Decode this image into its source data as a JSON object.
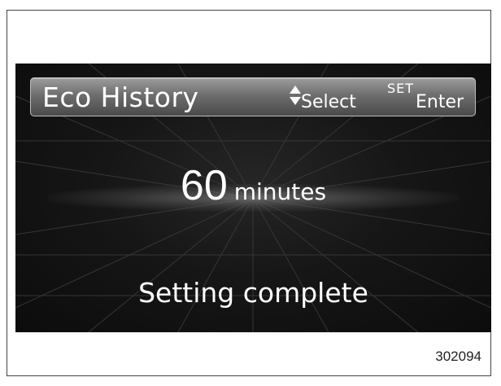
{
  "header": {
    "title": "Eco History",
    "select_label": "Select",
    "set_label": "SET",
    "enter_label": "Enter"
  },
  "setting": {
    "value": "60",
    "unit": "minutes"
  },
  "status": "Setting complete",
  "figure_id": "302094",
  "icons": [
    "up-down-arrows-icon"
  ],
  "colors": {
    "screen_background": "#161616",
    "header_bar": "#7a7a7a",
    "text": "#ffffff"
  }
}
